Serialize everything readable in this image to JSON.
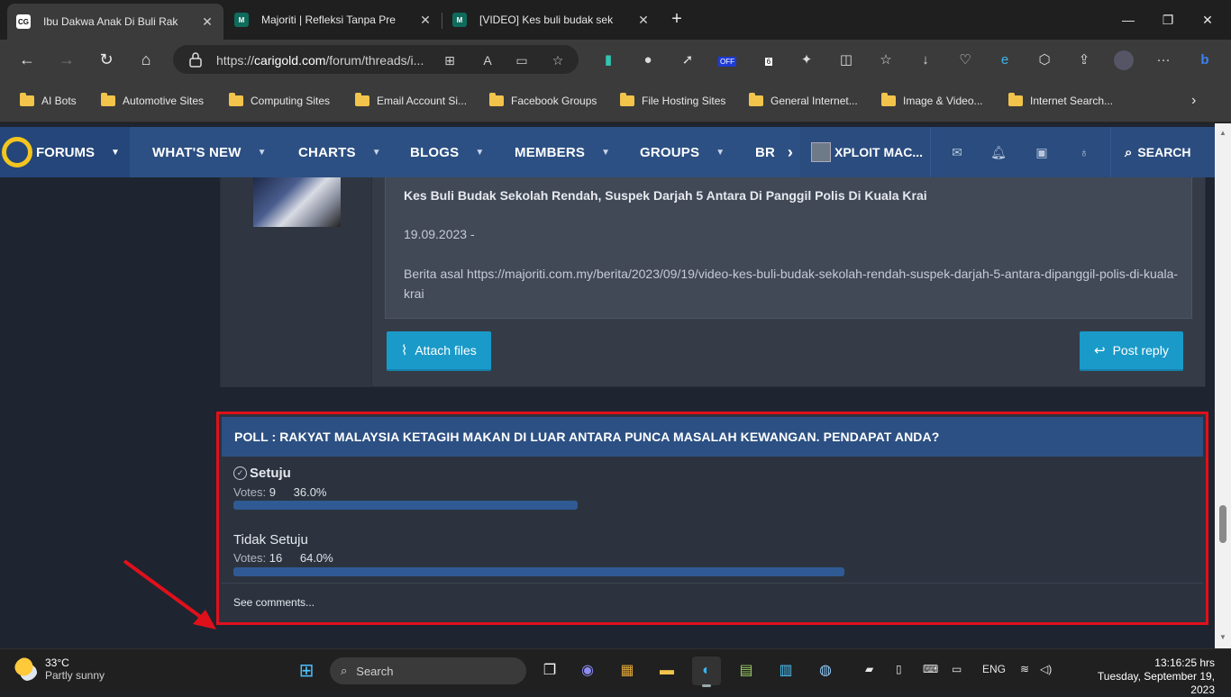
{
  "browser": {
    "tabs": [
      {
        "title": "Ibu Dakwa Anak Di Buli Rak",
        "favicon": "CG",
        "active": true
      },
      {
        "title": "Majoriti | Refleksi Tanpa Pre",
        "favicon": "M",
        "active": false
      },
      {
        "title": "[VIDEO] Kes buli budak sek",
        "favicon": "M",
        "active": false
      }
    ],
    "url_prefix": "https://",
    "url_domain": "carigold.com",
    "url_rest": "/forum/threads/i...",
    "extension_badges": {
      "off": "OFF",
      "count": "6"
    },
    "bookmarks": [
      "AI Bots",
      "Automotive Sites",
      "Computing Sites",
      "Email Account Si...",
      "Facebook Groups",
      "File Hosting Sites",
      "General Internet...",
      "Image & Video...",
      "Internet Search..."
    ]
  },
  "site_nav": {
    "items": [
      "FORUMS",
      "WHAT'S NEW",
      "CHARTS",
      "BLOGS",
      "MEMBERS",
      "GROUPS",
      "BR"
    ],
    "username": "XPLOIT MAC...",
    "search_label": "SEARCH"
  },
  "post": {
    "quote_title": "Kes Buli Budak Sekolah Rendah, Suspek Darjah 5 Antara Di Panggil Polis Di Kuala Krai",
    "quote_date": "19.09.2023 -",
    "quote_body": "Berita asal https://majoriti.com.my/berita/2023/09/19/video-kes-buli-budak-sekolah-rendah-suspek-darjah-5-antara-dipanggil-polis-di-kuala-krai",
    "attach_label": "Attach files",
    "reply_label": "Post reply"
  },
  "poll": {
    "title": "POLL : RAKYAT MALAYSIA KETAGIH MAKAN DI LUAR ANTARA PUNCA MASALAH KEWANGAN. PENDAPAT ANDA?",
    "votes_label": "Votes:",
    "options": [
      {
        "label": "Setuju",
        "votes": "9",
        "percent_text": "36.0%",
        "percent": 36.0,
        "voted": true
      },
      {
        "label": "Tidak Setuju",
        "votes": "16",
        "percent_text": "64.0%",
        "percent": 64.0,
        "voted": false
      }
    ],
    "see_comments": "See comments..."
  },
  "taskbar": {
    "temperature": "33°C",
    "weather": "Partly sunny",
    "search_placeholder": "Search",
    "language": "ENG",
    "time": "13:16:25 hrs",
    "date": "Tuesday, September 19, 2023"
  },
  "colors": {
    "accent": "#2c5083",
    "button": "#1a9ac9",
    "highlight_border": "#e0101b",
    "bar": "#2f5a94"
  }
}
